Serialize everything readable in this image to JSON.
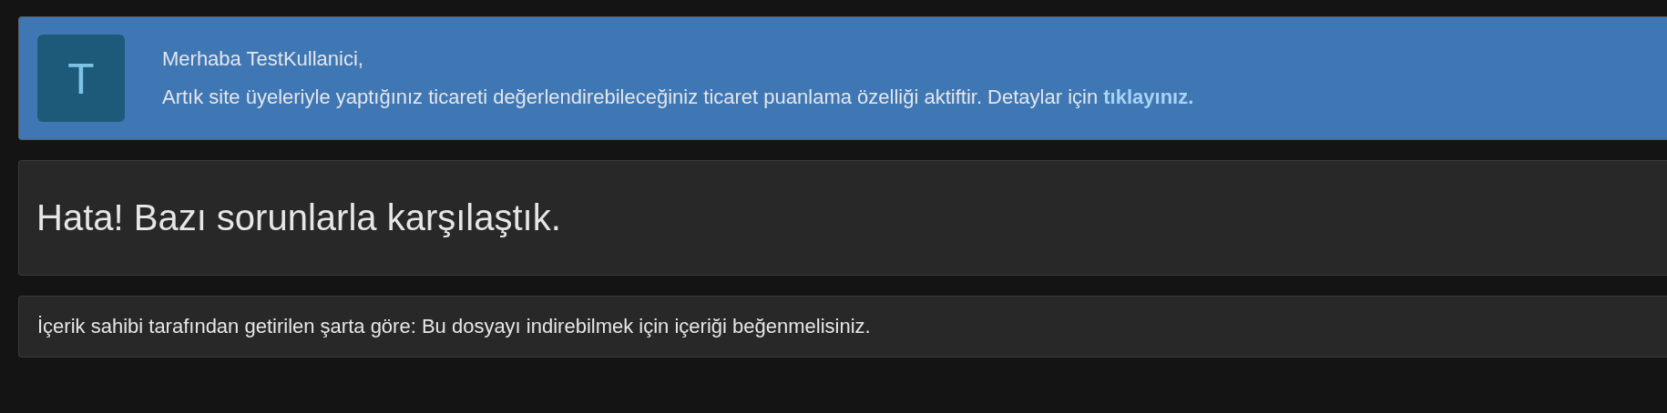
{
  "notice": {
    "avatar_letter": "T",
    "greeting": "Merhaba TestKullanici,",
    "message": "Artık site üyeleriyle yaptığınız ticareti değerlendirebileceğiniz ticaret puanlama özelliği aktiftir. Detaylar için",
    "link": "tıklayınız."
  },
  "error": {
    "title": "Hata! Bazı sorunlarla karşılaştık.",
    "detail": "İçerik sahibi tarafından getirilen şarta göre: Bu dosyayı indirebilmek için içeriği beğenmelisiniz."
  }
}
